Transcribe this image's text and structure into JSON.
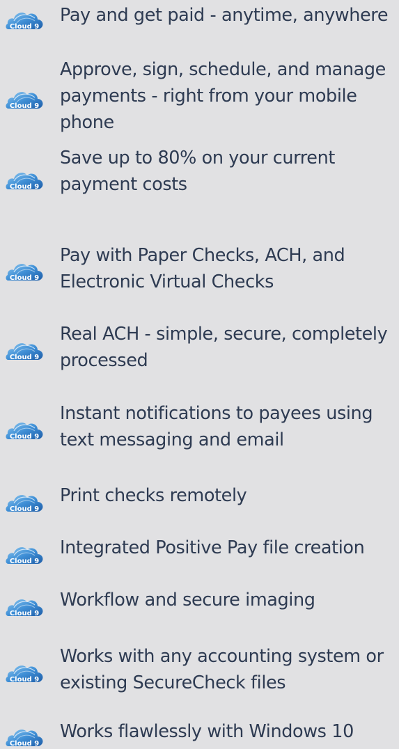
{
  "logo": {
    "brand_text": "Cloud 9",
    "icon": "cloud-9-logo-icon",
    "colors": {
      "cloud_light": "#8fc9f0",
      "cloud_mid": "#3f8fd6",
      "cloud_dark": "#1f5ea8",
      "text": "#ffffff"
    }
  },
  "features": [
    {
      "text": "Pay and get paid - anytime, anywhere"
    },
    {
      "text": "Approve, sign, schedule, and manage payments - right from your mobile phone"
    },
    {
      "text": "Save up to 80% on your current payment costs"
    },
    {
      "text": "Pay with Paper Checks, ACH, and Electronic Virtual Checks"
    },
    {
      "text": "Real ACH - simple, secure, completely processed"
    },
    {
      "text": "Instant notifications to payees using text messaging and email"
    },
    {
      "text": "Print checks remotely"
    },
    {
      "text": "Integrated Positive Pay file creation"
    },
    {
      "text": "Workflow and secure imaging"
    },
    {
      "text": "Works with any accounting system or existing SecureCheck files"
    },
    {
      "text": "Works flawlessly with Windows 10"
    }
  ],
  "colors": {
    "background": "#e1e1e3",
    "text": "#2e3b52"
  }
}
